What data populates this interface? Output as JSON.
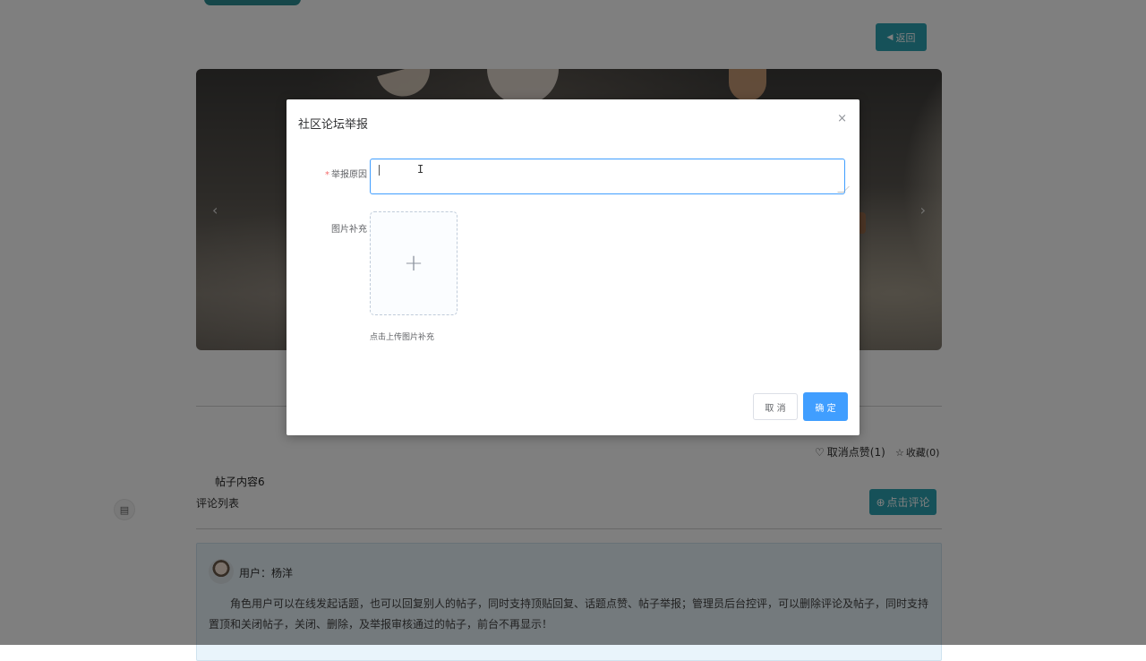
{
  "page": {
    "back_label": "返回",
    "like_label": "取消点赞(1)",
    "favorite_label": "收藏(0)",
    "post_content": "帖子内容6",
    "comment_list_title": "评论列表",
    "comment_button_label": "点击评论",
    "comment": {
      "user": "用户：杨洋",
      "text": "角色用户可以在线发起话题，也可以回复别人的帖子，同时支持顶贴回复、话题点赞、帖子举报；管理员后台控评，可以删除评论及帖子，同时支持置顶和关闭帖子，关闭、删除，及举报审核通过的帖子，前台不再显示！"
    }
  },
  "modal": {
    "title": "社区论坛举报",
    "close_symbol": "×",
    "reason_label": "举报原因",
    "required_mark": "*",
    "reason_value": "",
    "image_label": "图片补充",
    "upload_tip": "点击上传图片补充",
    "cancel_label": "取 消",
    "confirm_label": "确 定"
  },
  "icons": {
    "back": "caret-left-icon",
    "like": "heart-icon",
    "favorite": "star-icon",
    "comment": "plus-circle-icon",
    "upload": "plus-icon"
  },
  "colors": {
    "teal_button": "#2ca3b2",
    "primary": "#409eff",
    "required": "#f56c6c"
  }
}
